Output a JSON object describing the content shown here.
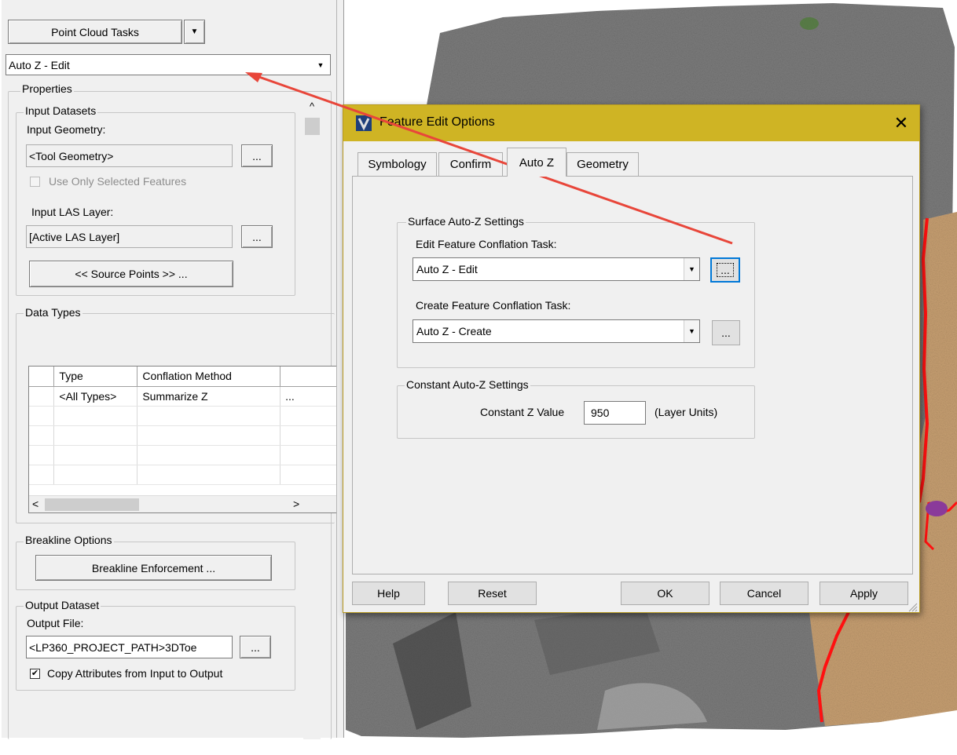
{
  "left_panel": {
    "task_button_label": "Point Cloud Tasks",
    "task_dropdown_arrow": "▼",
    "task_select_value": "Auto Z - Edit",
    "properties_label": "Properties",
    "input_datasets": {
      "group_label": "Input Datasets",
      "geometry_label": "Input Geometry:",
      "geometry_value": "<Tool Geometry>",
      "geometry_browse": "...",
      "use_selected_label": "Use Only Selected Features",
      "las_label": "Input LAS Layer:",
      "las_value": "[Active LAS Layer]",
      "las_browse": "...",
      "source_points_label": "<< Source Points >> ..."
    },
    "data_types": {
      "group_label": "Data Types",
      "columns": [
        "Type",
        "Conflation Method"
      ],
      "rows": [
        {
          "type": "<All Types>",
          "method": "Summarize Z",
          "more": "..."
        }
      ],
      "scroll_left": "<",
      "scroll_right": ">"
    },
    "breakline": {
      "group_label": "Breakline Options",
      "button_label": "Breakline Enforcement ..."
    },
    "output": {
      "group_label": "Output Dataset",
      "file_label": "Output File:",
      "file_value": "<LP360_PROJECT_PATH>3DToe",
      "browse": "...",
      "copy_attributes_label": "Copy Attributes from Input to Output",
      "copy_attributes_checked": true
    },
    "scroll_up": "^"
  },
  "dialog": {
    "title": "Feature Edit Options",
    "close_glyph": "✕",
    "tabs": [
      {
        "label": "Symbology",
        "active": false
      },
      {
        "label": "Confirm",
        "active": false
      },
      {
        "label": "Auto Z",
        "active": true
      },
      {
        "label": "Geometry",
        "active": false
      }
    ],
    "surface_group": {
      "label": "Surface Auto-Z Settings",
      "edit_label": "Edit Feature Conflation Task:",
      "edit_value": "Auto Z - Edit",
      "create_label": "Create Feature Conflation Task:",
      "create_value": "Auto Z - Create",
      "browse": "..."
    },
    "constant_group": {
      "label": "Constant Auto-Z Settings",
      "value_label": "Constant Z Value",
      "value": "950",
      "units": "(Layer Units)"
    },
    "buttons": {
      "help": "Help",
      "reset": "Reset",
      "ok": "OK",
      "cancel": "Cancel",
      "apply": "Apply"
    }
  },
  "colors": {
    "titlebar": "#cfb424",
    "annotation_arrow": "#e8463a",
    "boundary_line": "#ff1010",
    "terrain_tan": "#c8a072",
    "pointcloud_gray": "#7c7c7c"
  }
}
